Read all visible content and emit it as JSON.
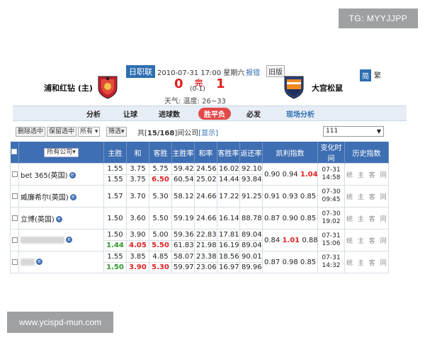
{
  "watermarks": {
    "top": "TG: MYYJJPP",
    "bottom": "www.ycispd-mun.com"
  },
  "match": {
    "league": "日职联",
    "datetime": "2010-07-31 17:00 星期六",
    "report": "报错",
    "old_version": "旧版",
    "lang_simplified": "简",
    "lang_traditional": "繁",
    "home_team": "浦和红钻 (主)",
    "away_team": "大宫松鼠",
    "home_score": "0",
    "away_score": "1",
    "status": "完",
    "half_score": "(0-1)",
    "weather": "天气:   温度: 26~33"
  },
  "colors": {
    "accent": "#3f6fb3",
    "red": "#e02020",
    "green": "#2a9a2a",
    "nav_bg": "#e6edf5"
  },
  "nav": {
    "items": [
      "分析",
      "让球",
      "进球数",
      "胜平负",
      "必发",
      "现场分析"
    ],
    "active_index": 3
  },
  "toolbar": {
    "delete_selected": "删除选中",
    "keep_selected": "保留选中",
    "filter_all": "所有",
    "filter": "筛选",
    "count_prefix": "共[",
    "count_value": "15/168",
    "count_suffix": "]间公司",
    "show": "[显示]",
    "company_select": "111"
  },
  "table": {
    "headers": {
      "all_companies": "所有公司",
      "home_win": "主胜",
      "draw": "和",
      "away_win": "客胜",
      "home_rate": "主胜率",
      "draw_rate": "和率",
      "away_rate": "客胜率",
      "return_rate": "返还率",
      "kelly": "凯利指数",
      "change_time": "变化时间",
      "history": "历史指数"
    },
    "rows": [
      {
        "company": "bet 365(英国)",
        "blurred": false,
        "open": [
          "1.55",
          "3.75",
          "5.75",
          "59.42",
          "24.56",
          "16.02",
          "92.10"
        ],
        "live": [
          "1.55",
          "3.75",
          "6.50",
          "60.54",
          "25.02",
          "14.44",
          "93.84"
        ],
        "live_colors": [
          "",
          "",
          "up",
          "",
          "",
          "",
          ""
        ],
        "kelly": [
          "0.90",
          "0.94",
          "1.04"
        ],
        "kelly_colors": [
          "",
          "",
          "up"
        ],
        "date": "07-31",
        "time": "14:58",
        "links": "统 主 客 同"
      },
      {
        "company": "威廉希尔(英国)",
        "blurred": false,
        "open": [
          "1.57",
          "3.70",
          "5.30",
          "58.12",
          "24.66",
          "17.22",
          "91.25"
        ],
        "live": null,
        "kelly": [
          "0.91",
          "0.93",
          "0.85"
        ],
        "kelly_colors": [
          "",
          "",
          ""
        ],
        "date": "07-30",
        "time": "09:45",
        "links": "统 主 客 同"
      },
      {
        "company": "立博(英国)",
        "blurred": false,
        "open": [
          "1.50",
          "3.60",
          "5.50",
          "59.19",
          "24.66",
          "16.14",
          "88.78"
        ],
        "live": null,
        "kelly": [
          "0.87",
          "0.90",
          "0.85"
        ],
        "kelly_colors": [
          "",
          "",
          ""
        ],
        "date": "07-30",
        "time": "19:02",
        "links": "统 主 客 同"
      },
      {
        "company": "",
        "blurred": true,
        "open": [
          "1.50",
          "3.90",
          "5.00",
          "59.36",
          "22.83",
          "17.81",
          "89.04"
        ],
        "live": [
          "1.44",
          "4.05",
          "5.50",
          "61.83",
          "21.98",
          "16.19",
          "89.04"
        ],
        "live_colors": [
          "down",
          "up",
          "up",
          "",
          "",
          "",
          ""
        ],
        "kelly": [
          "0.84",
          "1.01",
          "0.88"
        ],
        "kelly_colors": [
          "",
          "up",
          ""
        ],
        "date": "07-31",
        "time": "15:06",
        "links": "统 主 客 同"
      },
      {
        "company": "",
        "blurred": true,
        "open": [
          "1.55",
          "3.85",
          "4.85",
          "58.07",
          "23.38",
          "18.56",
          "90.01"
        ],
        "live": [
          "1.50",
          "3.90",
          "5.30",
          "59.97",
          "23.06",
          "16.97",
          "89.96"
        ],
        "live_colors": [
          "down",
          "up",
          "up",
          "",
          "",
          "",
          ""
        ],
        "kelly": [
          "0.87",
          "0.98",
          "0.85"
        ],
        "kelly_colors": [
          "",
          "",
          ""
        ],
        "date": "07-31",
        "time": "14:32",
        "links": "统 主 客 同"
      }
    ]
  }
}
